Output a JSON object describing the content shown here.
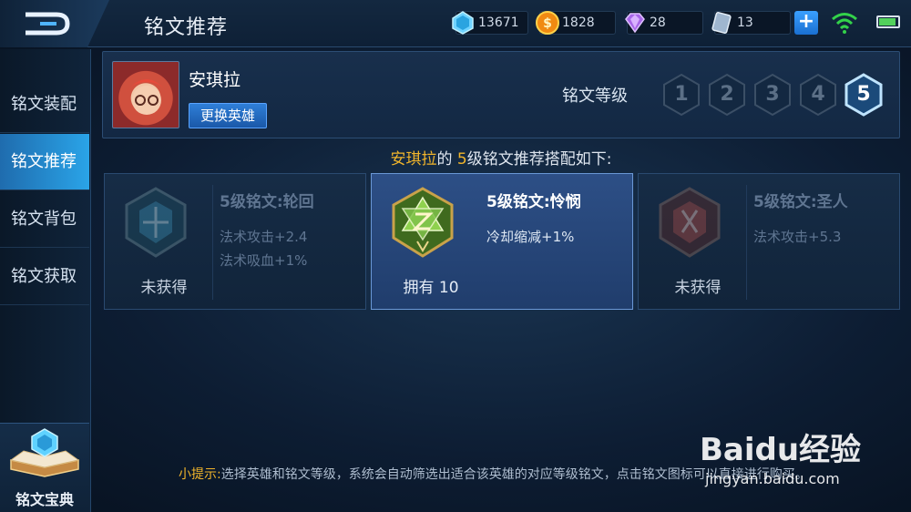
{
  "header": {
    "title": "铭文推荐",
    "currencies": [
      {
        "icon": "diamond-icon",
        "value": "13671"
      },
      {
        "icon": "gold-coin-icon",
        "value": "1828"
      },
      {
        "icon": "purple-gem-icon",
        "value": "28"
      },
      {
        "icon": "ticket-icon",
        "value": "13"
      }
    ]
  },
  "sidebar": {
    "items": [
      {
        "label": "铭文装配"
      },
      {
        "label": "铭文推荐"
      },
      {
        "label": "铭文背包"
      },
      {
        "label": "铭文获取"
      }
    ],
    "book_label": "铭文宝典"
  },
  "hero": {
    "name": "安琪拉",
    "swap_label": "更换英雄",
    "level_label": "铭文等级",
    "levels": [
      "1",
      "2",
      "3",
      "4",
      "5"
    ],
    "selected_level": "5"
  },
  "headline": {
    "hero": "安琪拉",
    "mid": "的 ",
    "level": "5",
    "rest": "级铭文推荐搭配如下:"
  },
  "cards": [
    {
      "name": "5级铭文:轮回",
      "stats": [
        "法术攻击+2.4",
        "法术吸血+1%"
      ],
      "status": "未获得",
      "color": "#3b8fb0"
    },
    {
      "name": "5级铭文:怜悯",
      "stats": [
        "冷却缩减+1%"
      ],
      "status": "拥有 10",
      "color": "#7fc24a"
    },
    {
      "name": "5级铭文:圣人",
      "stats": [
        "法术攻击+5.3"
      ],
      "status": "未获得",
      "color": "#b24a3e"
    }
  ],
  "tip": {
    "label": "小提示:",
    "text": "选择英雄和铭文等级，系统会自动筛选出适合该英雄的对应等级铭文，点击铭文图标可以直接进行购买。"
  },
  "watermark": {
    "brand": "Baidu经验",
    "url": "jingyan.baidu.com"
  }
}
